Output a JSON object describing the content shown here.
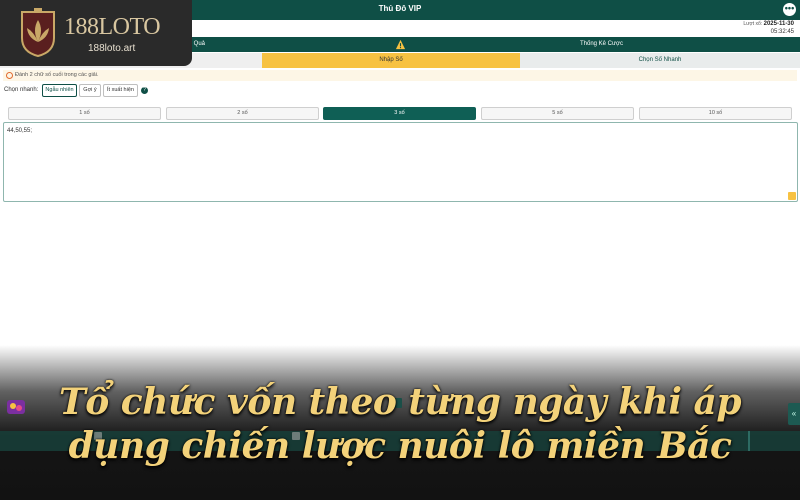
{
  "header": {
    "title": "Thủ Đô VIP",
    "menu_symbol": "•••"
  },
  "draw_info": {
    "label": "Lượt xổ:",
    "date": "2025-11-30",
    "time": "05:32:45"
  },
  "tabs": {
    "left": "n Kết Quả",
    "right": "Thống Kê Cược"
  },
  "modes": {
    "active": "Nhập Số",
    "other": "Chọn Số Nhanh"
  },
  "notice": "Đánh 2 chữ số cuối trong các giải.",
  "quick": {
    "label": "Chọn nhanh:",
    "buttons": [
      "Ngẫu nhiên",
      "Gợi ý",
      "Ít xuất hiện"
    ],
    "help_symbol": "?"
  },
  "counts": [
    "1 số",
    "2 số",
    "3 số",
    "5 số",
    "10 số"
  ],
  "counts_selected": "3 số",
  "number_input": "44,50,55;",
  "logo": {
    "brand": "188LOTO",
    "site": "188loto.art"
  },
  "caption": {
    "line1": "Tổ chức vốn theo từng ngày khi áp",
    "line2": "dụng chiến lược nuôi lô miền Bắc"
  },
  "side": {
    "arrow": "«",
    "page": "1"
  },
  "colors": {
    "primary": "#0f4f46",
    "accent": "#f7c242",
    "caption": "#f3d27a"
  }
}
